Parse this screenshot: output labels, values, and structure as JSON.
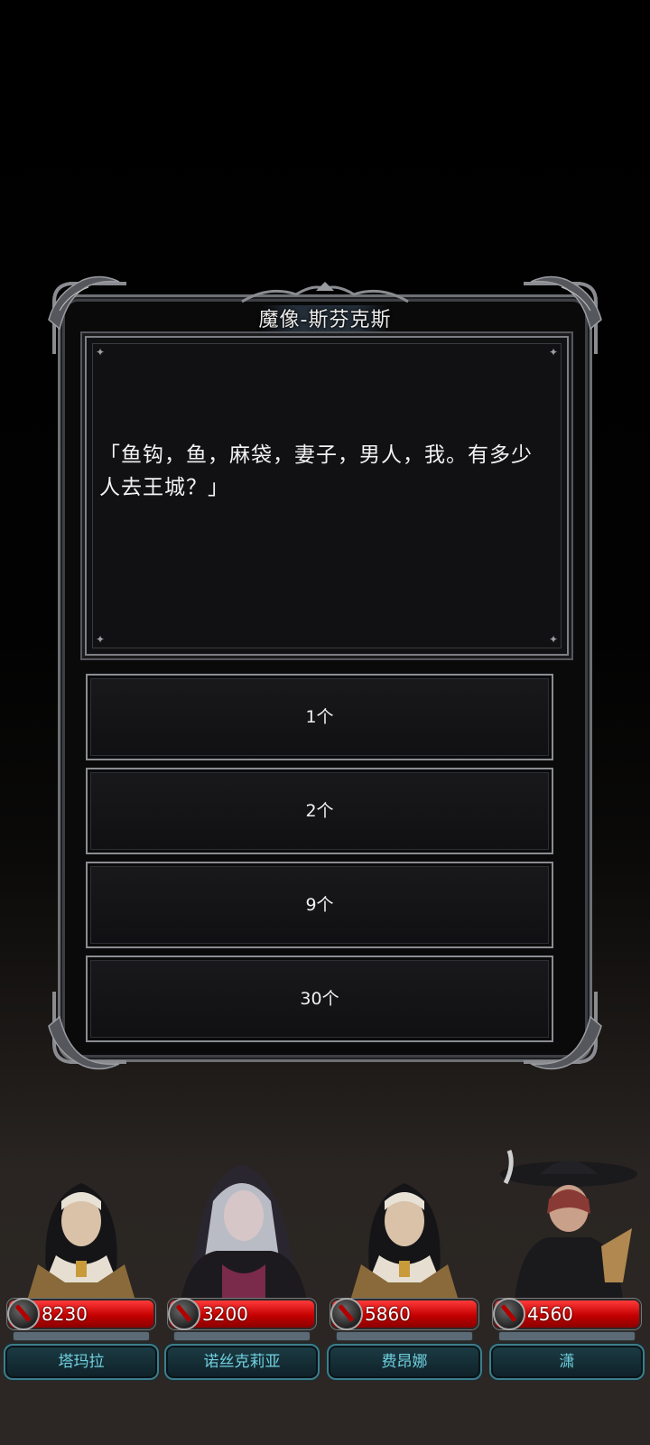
{
  "dialog": {
    "title": "魔像-斯芬克斯",
    "question": "「鱼钩，鱼，麻袋，妻子，男人，我。有多少人去王城？」",
    "answers": [
      "1个",
      "2个",
      "9个",
      "30个"
    ]
  },
  "party": [
    {
      "name": "塔玛拉",
      "hp": "8230"
    },
    {
      "name": "诺丝克莉亚",
      "hp": "3200"
    },
    {
      "name": "费昂娜",
      "hp": "5860"
    },
    {
      "name": "潇",
      "hp": "4560"
    }
  ],
  "colors": {
    "hp_bar": "#c40000",
    "nameplate_text": "#6fd0e0",
    "frame": "#6d6f73",
    "background": "#000000"
  },
  "icons": {
    "hp": "sword-hp-icon",
    "sparkle": "sparkle-icon"
  }
}
